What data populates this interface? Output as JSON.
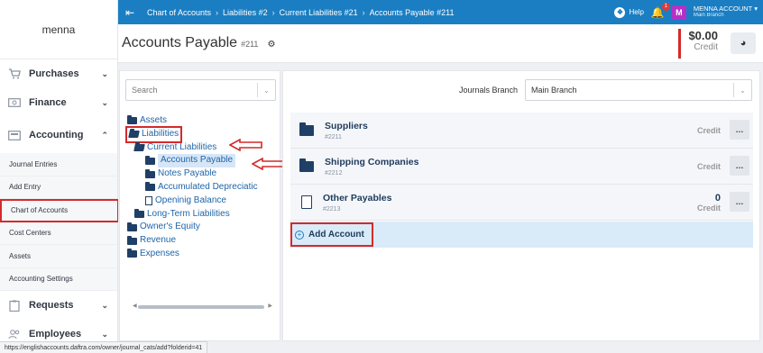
{
  "sidebar": {
    "brand": "menna",
    "items_top": [
      {
        "label": "Purchases",
        "icon": "cart-icon"
      },
      {
        "label": "Finance",
        "icon": "money-icon"
      },
      {
        "label": "Accounting",
        "icon": "calculator-icon"
      }
    ],
    "sub_items": [
      {
        "label": "Journal Entries"
      },
      {
        "label": "Add Entry"
      },
      {
        "label": "Chart of Accounts"
      },
      {
        "label": "Cost Centers"
      },
      {
        "label": "Assets"
      },
      {
        "label": "Accounting Settings"
      }
    ],
    "items_bottom": [
      {
        "label": "Requests",
        "icon": "clipboard-icon"
      },
      {
        "label": "Employees",
        "icon": "people-icon"
      }
    ]
  },
  "topbar": {
    "breadcrumbs": [
      "Chart of Accounts",
      "Liabilities #2",
      "Current Liabilities #21",
      "Accounts Payable #211"
    ],
    "help": "Help",
    "notification_count": "1",
    "avatar_letter": "M",
    "account_name": "MENNA ACCOUNT",
    "account_branch": "Main Branch",
    "color": "#1b7ec2"
  },
  "header": {
    "title": "Accounts Payable",
    "number": "#211",
    "balance": "$0.00",
    "balance_label": "Credit"
  },
  "tree_panel": {
    "search_placeholder": "Search",
    "nodes": {
      "assets": "Assets",
      "liabilities": "Liabilities",
      "current_liabilities": "Current Liabilities",
      "accounts_payable": "Accounts Payable",
      "notes_payable": "Notes Payable",
      "accumulated_dep": "Accumulated Depreciatic",
      "opening_balance": "Openinig Balance",
      "long_term": "Long-Term Liabilities",
      "owners_equity": "Owner's Equity",
      "revenue": "Revenue",
      "expenses": "Expenses"
    }
  },
  "main_panel": {
    "branch_label": "Journals Branch",
    "branch_value": "Main Branch",
    "accounts": [
      {
        "name": "Suppliers",
        "code": "#2211",
        "value": "",
        "type": "Credit",
        "icon": "folder"
      },
      {
        "name": "Shipping Companies",
        "code": "#2212",
        "value": "",
        "type": "Credit",
        "icon": "folder"
      },
      {
        "name": "Other Payables",
        "code": "#2213",
        "value": "0",
        "type": "Credit",
        "icon": "document"
      }
    ],
    "add_account": "Add Account"
  },
  "status_url": "https://englishaccounts.daftra.com/owner/journal_cats/add?folderid=41",
  "accent_colors": {
    "highlight": "#d42a2a",
    "link": "#1f64a8"
  }
}
